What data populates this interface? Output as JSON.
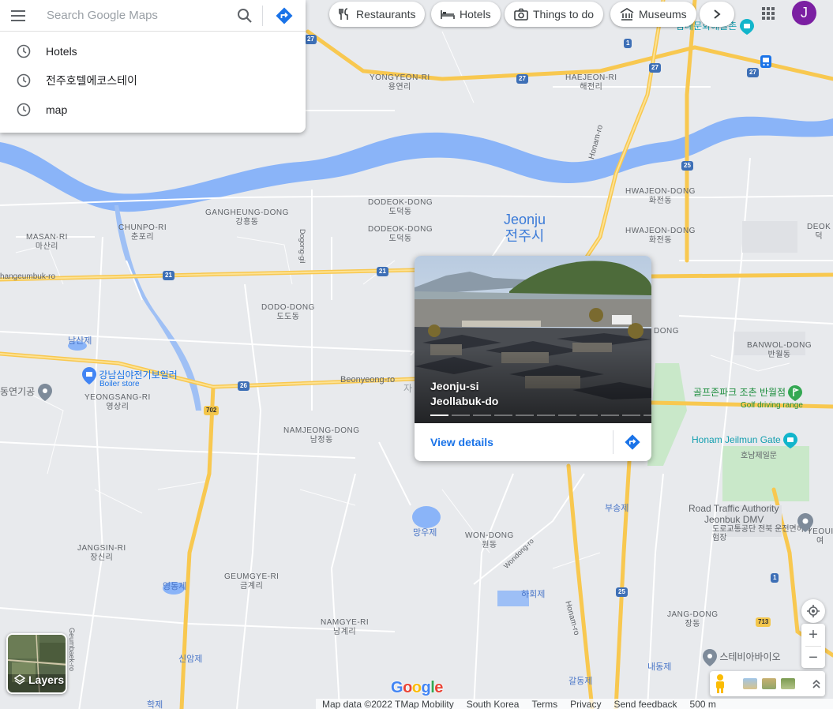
{
  "search": {
    "placeholder": "Search Google Maps",
    "history": [
      {
        "label": "Hotels"
      },
      {
        "label": "전주호텔에코스테이"
      },
      {
        "label": "map"
      }
    ]
  },
  "chips": [
    {
      "label": "Restaurants",
      "icon": "fork-knife-icon"
    },
    {
      "label": "Hotels",
      "icon": "bed-icon"
    },
    {
      "label": "Things to do",
      "icon": "camera-icon"
    },
    {
      "label": "Museums",
      "icon": "museum-icon"
    }
  ],
  "account": {
    "initial": "J",
    "color": "#7b1fa2"
  },
  "place_card": {
    "title": "Jeonju-si",
    "subtitle": "Jeollabuk-do",
    "link": "View details"
  },
  "map": {
    "city": {
      "en": "Jeonju",
      "ko": "전주시"
    },
    "neighborhoods": [
      {
        "en": "YONGYEON-RI",
        "ko": "용연리"
      },
      {
        "en": "HAEJEON-RI",
        "ko": "해전리"
      },
      {
        "en": "GANGHEUNG-DONG",
        "ko": "강흥동"
      },
      {
        "en": "DODEOK-DONG",
        "ko": "도덕동"
      },
      {
        "en": "DODEOK-DONG",
        "ko": "도덕동"
      },
      {
        "en": "CHUNPO-RI",
        "ko": "춘포리"
      },
      {
        "en": "MASAN-RI",
        "ko": "마산리"
      },
      {
        "en": "HWAJEON-DONG",
        "ko": "화전동"
      },
      {
        "en": "HWAJEON-DONG",
        "ko": "화전동"
      },
      {
        "en": "DODO-DONG",
        "ko": "도도동"
      },
      {
        "en": "YEONGSANG-RI",
        "ko": "영상리"
      },
      {
        "en": "NAMJEONG-DONG",
        "ko": "남정동"
      },
      {
        "en": "BANWOL-DONG",
        "ko": "반월동"
      },
      {
        "en": "WON-DONG",
        "ko": "원동"
      },
      {
        "en": "JANGSIN-RI",
        "ko": "장신리"
      },
      {
        "en": "GEUMGYE-RI",
        "ko": "금계리"
      },
      {
        "en": "NAMGYE-RI",
        "ko": "남계리"
      },
      {
        "en": "JANG-DONG",
        "ko": "장동"
      },
      {
        "en": "DEOK",
        "ko": "덕"
      },
      {
        "en": "YEOUI",
        "ko": "여"
      }
    ],
    "water": [
      "남산제",
      "망우제",
      "영동제",
      "하회제",
      "신암제",
      "부송제",
      "갈동제",
      "내동제",
      "학제"
    ],
    "roads": [
      "Beonyeong-ro",
      "Honam-ro",
      "Honam-ro",
      "Dogong-gil",
      "Wondong-ro",
      "hangeumbuk-ro",
      "Geumbaek-ro"
    ],
    "shields": [
      "27",
      "27",
      "27",
      "27",
      "1",
      "25",
      "21",
      "21",
      "26",
      "702",
      "25",
      "1",
      "713"
    ],
    "pois": [
      {
        "name": "Honam Jeilmun Gate",
        "ko": "호남제일문",
        "color": "#129eaf"
      },
      {
        "name": "골프존파크 조촌 반월점",
        "sub": "Golf driving range",
        "color": "#1e8e3e"
      },
      {
        "name": "강남심야전기보일러",
        "sub": "Boiler store",
        "color": "#1a73e8"
      },
      {
        "name": "Road Traffic Authority",
        "sub": "Jeonbuk DMV",
        "ko": "도로교통공단 전북 운전면허시험장",
        "color": "#5f6368"
      },
      {
        "name": "스테비아바이오",
        "color": "#5f6368"
      },
      {
        "name": "삼례문화예술촌",
        "color": "#129eaf"
      },
      {
        "name": "동연기공",
        "color": "#5f6368"
      },
      {
        "name": "자",
        "color": "#5f6368"
      },
      {
        "name": "DONG",
        "color": "#5f6368"
      }
    ]
  },
  "controls": {
    "layers_label": "Layers",
    "zoom_in": "+",
    "zoom_out": "−"
  },
  "footer": {
    "map_data": "Map data ©2022 TMap Mobility",
    "region": "South Korea",
    "terms": "Terms",
    "privacy": "Privacy",
    "feedback": "Send feedback",
    "scale": "500 m"
  },
  "logo": "Google"
}
